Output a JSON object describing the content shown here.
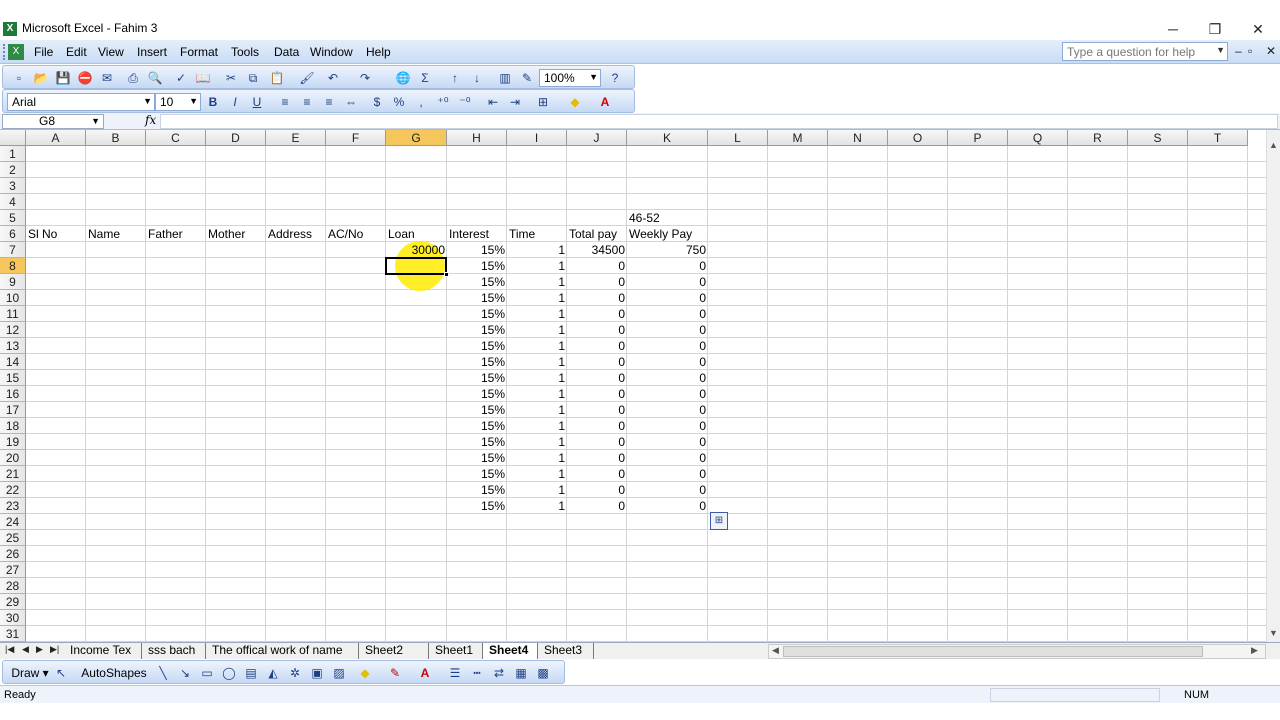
{
  "window": {
    "title": "Microsoft Excel - Fahim 3",
    "app_icon_letter": "X",
    "min_glyph": "─",
    "restore_glyph": "❐",
    "close_glyph": "✕"
  },
  "menu": {
    "items": [
      "File",
      "Edit",
      "View",
      "Insert",
      "Format",
      "Tools",
      "Data",
      "Window",
      "Help"
    ],
    "help_placeholder": "Type a question for help",
    "mdi_min": "‒",
    "mdi_restore": "▫",
    "mdi_close": "✕"
  },
  "standard_toolbar": {
    "zoom": "100%"
  },
  "formatting_toolbar": {
    "font": "Arial",
    "size": "10",
    "bold": "B",
    "italic": "I",
    "underline": "U",
    "currency": "$",
    "percent": "%",
    "comma": ","
  },
  "formula_bar": {
    "name_box": "G8",
    "fx": "fx",
    "value": ""
  },
  "columns": [
    "A",
    "B",
    "C",
    "D",
    "E",
    "F",
    "G",
    "H",
    "I",
    "J",
    "K",
    "L",
    "M",
    "N",
    "O",
    "P",
    "Q",
    "R",
    "S",
    "T"
  ],
  "selected_column": "G",
  "rows": [
    "1",
    "2",
    "3",
    "4",
    "5",
    "6",
    "7",
    "8",
    "9",
    "10",
    "11",
    "12",
    "13",
    "14",
    "15",
    "16",
    "17",
    "18",
    "19",
    "20",
    "21",
    "22",
    "23",
    "24",
    "25",
    "26",
    "27",
    "28",
    "29",
    "30",
    "31"
  ],
  "selected_row": "8",
  "cells": {
    "K5": "46-52",
    "headers": {
      "A6": "Sl No",
      "B6": "Name",
      "C6": "Father",
      "D6": "Mother",
      "E6": "Address",
      "F6": "AC/No",
      "G6": "Loan",
      "H6": "Interest",
      "I6": "Time",
      "J6": "Total pay",
      "K6": "Weekly Pay"
    },
    "data_rows": [
      {
        "row": "7",
        "G": "30000",
        "H": "15%",
        "I": "1",
        "J": "34500",
        "K": "750"
      },
      {
        "row": "8",
        "G": "",
        "H": "15%",
        "I": "1",
        "J": "0",
        "K": "0"
      },
      {
        "row": "9",
        "G": "",
        "H": "15%",
        "I": "1",
        "J": "0",
        "K": "0"
      },
      {
        "row": "10",
        "G": "",
        "H": "15%",
        "I": "1",
        "J": "0",
        "K": "0"
      },
      {
        "row": "11",
        "G": "",
        "H": "15%",
        "I": "1",
        "J": "0",
        "K": "0"
      },
      {
        "row": "12",
        "G": "",
        "H": "15%",
        "I": "1",
        "J": "0",
        "K": "0"
      },
      {
        "row": "13",
        "G": "",
        "H": "15%",
        "I": "1",
        "J": "0",
        "K": "0"
      },
      {
        "row": "14",
        "G": "",
        "H": "15%",
        "I": "1",
        "J": "0",
        "K": "0"
      },
      {
        "row": "15",
        "G": "",
        "H": "15%",
        "I": "1",
        "J": "0",
        "K": "0"
      },
      {
        "row": "16",
        "G": "",
        "H": "15%",
        "I": "1",
        "J": "0",
        "K": "0"
      },
      {
        "row": "17",
        "G": "",
        "H": "15%",
        "I": "1",
        "J": "0",
        "K": "0"
      },
      {
        "row": "18",
        "G": "",
        "H": "15%",
        "I": "1",
        "J": "0",
        "K": "0"
      },
      {
        "row": "19",
        "G": "",
        "H": "15%",
        "I": "1",
        "J": "0",
        "K": "0"
      },
      {
        "row": "20",
        "G": "",
        "H": "15%",
        "I": "1",
        "J": "0",
        "K": "0"
      },
      {
        "row": "21",
        "G": "",
        "H": "15%",
        "I": "1",
        "J": "0",
        "K": "0"
      },
      {
        "row": "22",
        "G": "",
        "H": "15%",
        "I": "1",
        "J": "0",
        "K": "0"
      },
      {
        "row": "23",
        "G": "",
        "H": "15%",
        "I": "1",
        "J": "0",
        "K": "0"
      }
    ]
  },
  "sheet_tabs": [
    "Income Tex",
    "sss bach",
    "The offical work of name",
    "Sheet2",
    "Sheet1",
    "Sheet4",
    "Sheet3"
  ],
  "active_sheet": "Sheet4",
  "draw_toolbar": {
    "draw": "Draw ▾",
    "autoshapes": "AutoShapes ▾"
  },
  "status": {
    "left": "Ready",
    "right": "NUM"
  },
  "colors": {
    "accent": "#f4c65c",
    "cursor_highlight": "#ffeb00",
    "toolbar": "#c6d9f4"
  }
}
